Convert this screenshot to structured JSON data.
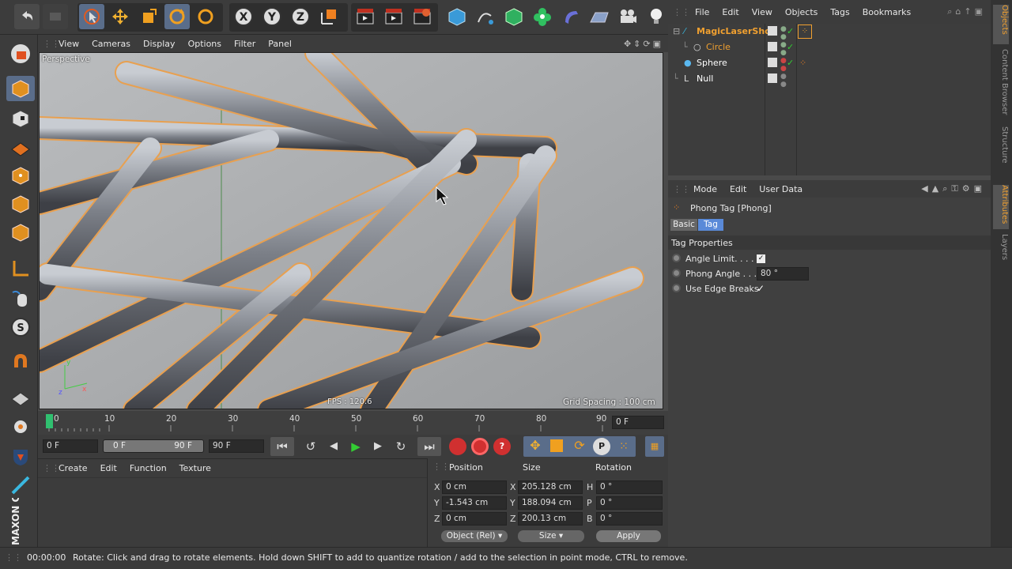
{
  "viewport": {
    "menu": [
      "View",
      "Cameras",
      "Display",
      "Options",
      "Filter",
      "Panel"
    ],
    "label": "Perspective",
    "fps": "FPS : 120.6",
    "grid_spacing": "Grid Spacing : 100 cm"
  },
  "timeline": {
    "ticks": [
      "0",
      "10",
      "20",
      "30",
      "40",
      "50",
      "60",
      "70",
      "80",
      "90"
    ],
    "current_frame": "0 F"
  },
  "anim": {
    "start_field": "0 F",
    "range_start": "0 F",
    "range_end": "90 F",
    "end_field": "90 F"
  },
  "material_manager": {
    "menu": [
      "Create",
      "Edit",
      "Function",
      "Texture"
    ]
  },
  "coords": {
    "headers": [
      "Position",
      "Size",
      "Rotation"
    ],
    "rows": [
      {
        "axis": "X",
        "pos": "0 cm",
        "saxis": "X",
        "size": "205.128 cm",
        "raxis": "H",
        "rot": "0 °"
      },
      {
        "axis": "Y",
        "pos": "-1.543 cm",
        "saxis": "Y",
        "size": "188.094 cm",
        "raxis": "P",
        "rot": "0 °"
      },
      {
        "axis": "Z",
        "pos": "0 cm",
        "saxis": "Z",
        "size": "200.13 cm",
        "raxis": "B",
        "rot": "0 °"
      }
    ],
    "mode_dropdown": "Object (Rel)",
    "size_dropdown": "Size",
    "apply_button": "Apply"
  },
  "status": {
    "time": "00:00:00",
    "message": "Rotate: Click and drag to rotate elements. Hold down SHIFT to add to quantize rotation / add to the selection in point mode, CTRL to remove."
  },
  "object_manager": {
    "menu": [
      "File",
      "Edit",
      "View",
      "Objects",
      "Tags",
      "Bookmarks"
    ],
    "objects": [
      {
        "name": "MagicLaserShot",
        "color": "#f0a030"
      },
      {
        "name": "Circle",
        "color": "#f0a030"
      },
      {
        "name": "Sphere",
        "color": "#ffffff"
      },
      {
        "name": "Null",
        "color": "#ffffff"
      }
    ]
  },
  "attributes": {
    "menu": [
      "Mode",
      "Edit",
      "User Data"
    ],
    "title": "Phong Tag [Phong]",
    "tabs": [
      "Basic",
      "Tag"
    ],
    "section": "Tag Properties",
    "props": [
      {
        "label": "Angle Limit. . . . .",
        "value": ""
      },
      {
        "label": "Phong Angle . . .",
        "value": "80 °"
      },
      {
        "label": "Use Edge Breaks",
        "value": ""
      }
    ]
  },
  "right_tabs": [
    "Objects",
    "Content Browser",
    "Structure",
    "Attributes",
    "Layers"
  ],
  "branding": "MAXON CINEMA",
  "colors": {
    "accent": "#f0a030",
    "selection_blue": "#5a8ad8"
  }
}
